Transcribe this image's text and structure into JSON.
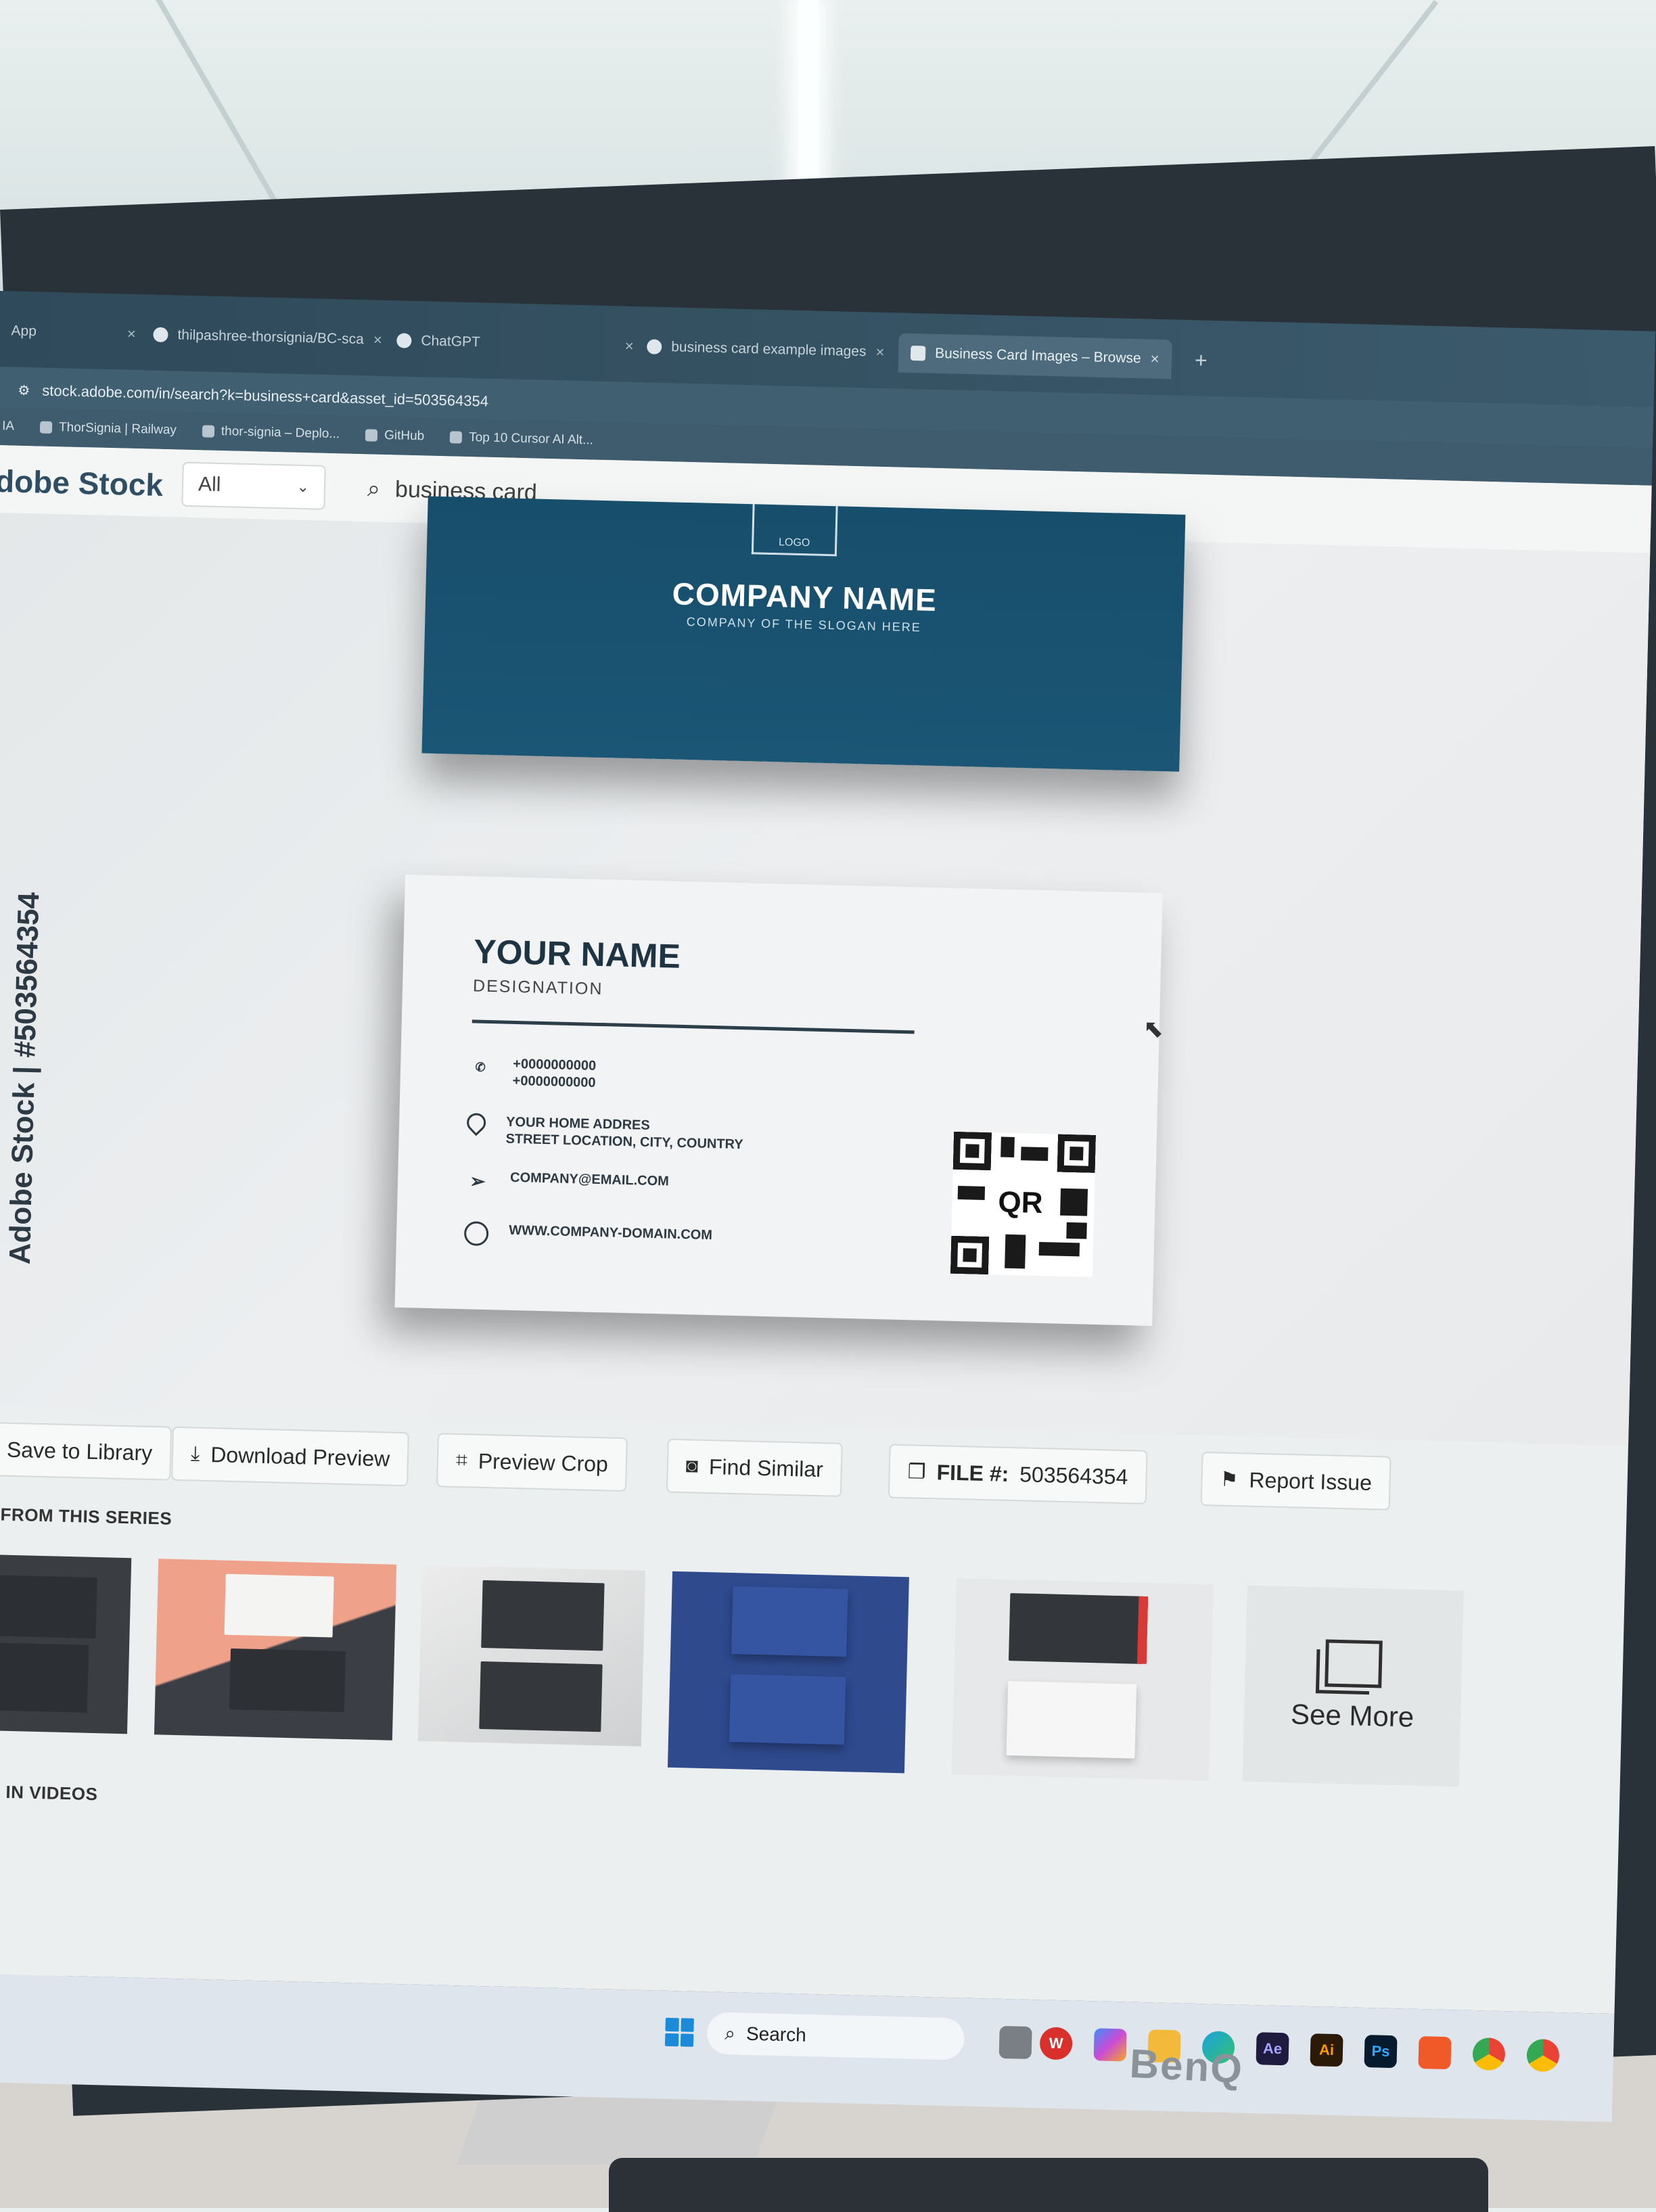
{
  "browser": {
    "tabs": [
      {
        "label": "App",
        "active": false
      },
      {
        "label": "thilpashree-thorsignia/BC-sca",
        "active": false
      },
      {
        "label": "ChatGPT",
        "active": false
      },
      {
        "label": "business card example images",
        "active": false
      },
      {
        "label": "Business Card Images – Browse",
        "active": true
      }
    ],
    "new_tab_glyph": "+",
    "close_glyph": "×",
    "url": "stock.adobe.com/in/search?k=business+card&asset_id=503564354",
    "bookmarks": [
      "ThorSignia | Railway",
      "thor-signia – Deplo...",
      "GitHub",
      "Top 10 Cursor AI Alt..."
    ]
  },
  "header": {
    "logo": "dobe Stock",
    "scope": "All",
    "search_query": "business card"
  },
  "viewer": {
    "vertical_label": "Adobe Stock | #503564354",
    "card_front": {
      "logo_text": "LOGO",
      "company": "COMPANY NAME",
      "slogan": "COMPANY OF THE SLOGAN  HERE"
    },
    "card_back": {
      "name": "YOUR NAME",
      "designation": "DESIGNATION",
      "phone1": "+0000000000",
      "phone2": "+0000000000",
      "address1": "YOUR HOME ADDRES",
      "address2": "STREET LOCATION, CITY, COUNTRY",
      "email": "COMPANY@EMAIL.COM",
      "website": "WWW.COMPANY-DOMAIN.COM",
      "qr_label": "QR"
    }
  },
  "actions": {
    "save": "Save to Library",
    "download": "Download Preview",
    "crop": "Preview Crop",
    "similar": "Find Similar",
    "file_label": "FILE #:",
    "file_number": "503564354",
    "report": "Report Issue"
  },
  "sections": {
    "series": "RE FROM THIS SERIES",
    "videos": "LAR IN VIDEOS"
  },
  "see_more": "See More",
  "taskbar": {
    "search_label": "Search",
    "apps": [
      "Ae",
      "Ai",
      "Ps"
    ]
  },
  "monitor_brand": "BenQ",
  "colors": {
    "card_blue": "#1b5676",
    "accent_windows": "#1b8ad8"
  }
}
